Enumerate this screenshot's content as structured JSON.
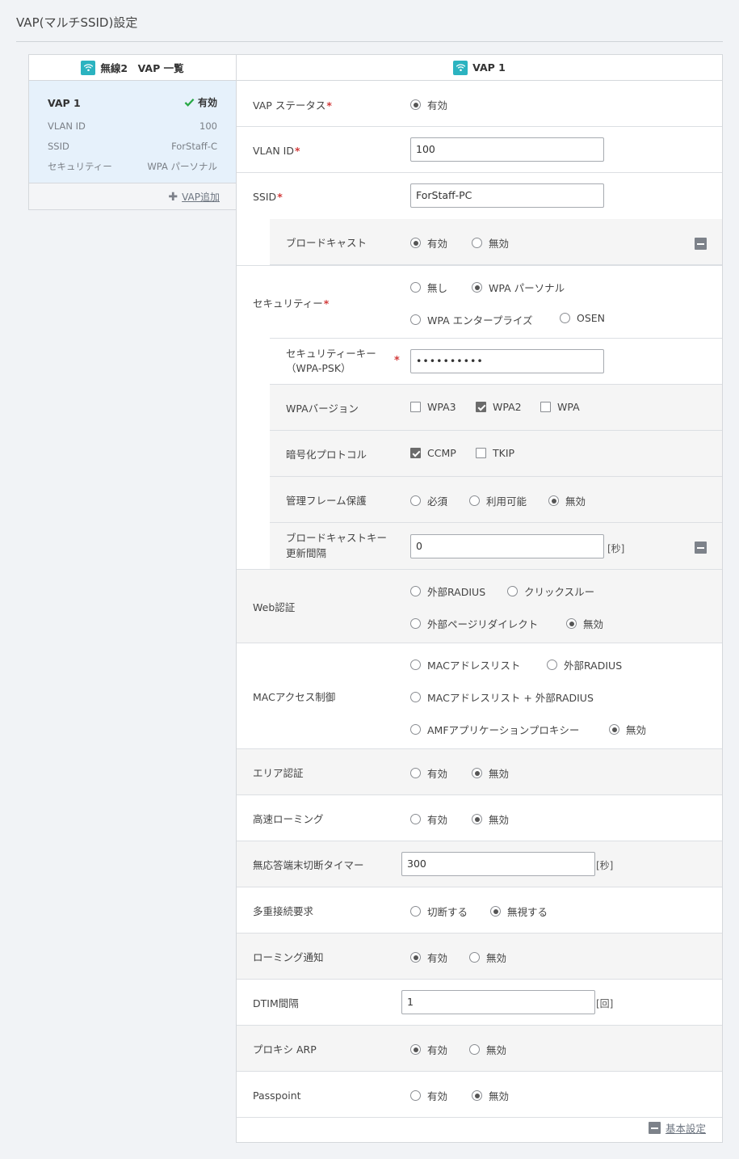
{
  "page": {
    "title": "VAP(マルチSSID)設定"
  },
  "list_panel": {
    "header": "無線2　VAP 一覧",
    "vap": {
      "name": "VAP 1",
      "status": "有効",
      "fields": [
        {
          "key": "VLAN ID",
          "value": "100"
        },
        {
          "key": "SSID",
          "value": "ForStaff-C"
        },
        {
          "key": "セキュリティー",
          "value": "WPA パーソナル"
        }
      ]
    },
    "add_label": "VAP追加"
  },
  "form": {
    "header": "VAP 1",
    "vap_status": {
      "label": "VAP ステータス",
      "opt_enabled": "有効"
    },
    "vlan_id": {
      "label": "VLAN ID",
      "value": "100"
    },
    "ssid": {
      "label": "SSID",
      "value": "ForStaff-PC"
    },
    "broadcast": {
      "label": "ブロードキャスト",
      "opt_on": "有効",
      "opt_off": "無効"
    },
    "security": {
      "label": "セキュリティー",
      "opt_none": "無し",
      "opt_personal": "WPA パーソナル",
      "opt_enterprise": "WPA エンタープライズ",
      "opt_osen": "OSEN"
    },
    "security_key": {
      "label1": "セキュリティーキー",
      "label2": "（WPA-PSK）",
      "value": "••••••••••"
    },
    "wpa_version": {
      "label": "WPAバージョン",
      "opt_wpa3": "WPA3",
      "opt_wpa2": "WPA2",
      "opt_wpa": "WPA"
    },
    "encryption": {
      "label": "暗号化プロトコル",
      "opt_ccmp": "CCMP",
      "opt_tkip": "TKIP"
    },
    "pmf": {
      "label": "管理フレーム保護",
      "opt_required": "必須",
      "opt_capable": "利用可能",
      "opt_disabled": "無効"
    },
    "bcast_key": {
      "label1": "ブロードキャストキー",
      "label2": "更新間隔",
      "value": "0",
      "unit": "[秒]"
    },
    "web_auth": {
      "label": "Web認証",
      "opt_radius": "外部RADIUS",
      "opt_click": "クリックスルー",
      "opt_redirect": "外部ページリダイレクト",
      "opt_disabled": "無効"
    },
    "mac_acl": {
      "label": "MACアクセス制御",
      "opt_list": "MACアドレスリスト",
      "opt_radius": "外部RADIUS",
      "opt_list_radius": "MACアドレスリスト + 外部RADIUS",
      "opt_amf": "AMFアプリケーションプロキシー",
      "opt_disabled": "無効"
    },
    "area_auth": {
      "label": "エリア認証",
      "opt_on": "有効",
      "opt_off": "無効"
    },
    "fast_roaming": {
      "label": "高速ローミング",
      "opt_on": "有効",
      "opt_off": "無効"
    },
    "idle_timer": {
      "label": "無応答端末切断タイマー",
      "value": "300",
      "unit": "[秒]"
    },
    "multi_conn": {
      "label": "多重接続要求",
      "opt_disconnect": "切断する",
      "opt_ignore": "無視する"
    },
    "roaming_notice": {
      "label": "ローミング通知",
      "opt_on": "有効",
      "opt_off": "無効"
    },
    "dtim": {
      "label": "DTIM間隔",
      "value": "1",
      "unit": "[回]"
    },
    "proxy_arp": {
      "label": "プロキシ ARP",
      "opt_on": "有効",
      "opt_off": "無効"
    },
    "passpoint": {
      "label": "Passpoint",
      "opt_on": "有効",
      "opt_off": "無効"
    },
    "footer_link": "基本設定"
  },
  "colors": {
    "accent": "#2bb3c0",
    "required": "#d23b3b",
    "selected_bg": "#e6f1fb"
  }
}
